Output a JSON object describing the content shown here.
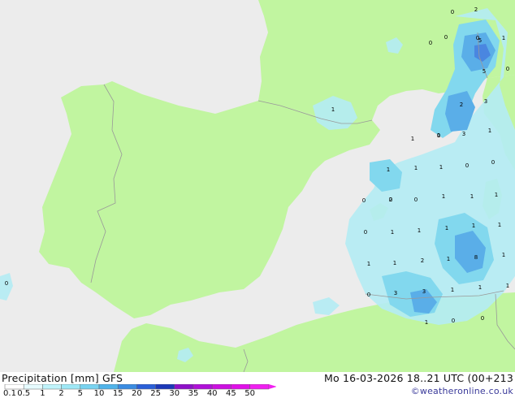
{
  "header": {
    "parameter": "Precipitation [mm]",
    "model": "GFS",
    "valid_time": "Mo 16-03-2026 18..21 UTC (00+213",
    "credit": "©weatheronline.co.uk"
  },
  "colors": {
    "sea": "#ececec",
    "land": "#c1f5a0",
    "precip_light": "#b4ecf4",
    "precip_mid": "#82d8ee",
    "precip_heavy": "#5aaee8",
    "precip_core": "#4a86e0",
    "border": "#999999"
  },
  "scale": {
    "labels": [
      "0.1",
      "0.5",
      "1",
      "2",
      "5",
      "10",
      "15",
      "20",
      "25",
      "30",
      "35",
      "40",
      "45",
      "50"
    ],
    "colors": [
      "#ffffff",
      "#e6fbff",
      "#bff3fb",
      "#9ee8f6",
      "#78d3f0",
      "#50b4ea",
      "#3a8ce2",
      "#2a5fd8",
      "#1c38b8",
      "#8e10c8",
      "#b010d8",
      "#cc10e0",
      "#e010e8",
      "#f020f0"
    ]
  },
  "map_labels": [
    {
      "text": "0"
    },
    {
      "text": "2"
    },
    {
      "text": "0"
    },
    {
      "text": "0"
    },
    {
      "text": "5"
    },
    {
      "text": "1"
    },
    {
      "text": "0"
    },
    {
      "text": "5"
    },
    {
      "text": "0"
    },
    {
      "text": "1"
    },
    {
      "text": "2"
    },
    {
      "text": "3"
    },
    {
      "text": "1"
    },
    {
      "text": "3"
    },
    {
      "text": "1"
    },
    {
      "text": "1"
    },
    {
      "text": "0"
    },
    {
      "text": "0"
    },
    {
      "text": "1"
    },
    {
      "text": "1"
    },
    {
      "text": "1"
    },
    {
      "text": "0"
    },
    {
      "text": "0"
    },
    {
      "text": "0"
    },
    {
      "text": "2"
    },
    {
      "text": "1"
    },
    {
      "text": "1"
    },
    {
      "text": "1"
    },
    {
      "text": "1"
    },
    {
      "text": "1"
    },
    {
      "text": "0"
    },
    {
      "text": "1"
    },
    {
      "text": "1"
    },
    {
      "text": "1"
    },
    {
      "text": "1"
    },
    {
      "text": "1"
    },
    {
      "text": "2"
    },
    {
      "text": "1"
    },
    {
      "text": "8"
    },
    {
      "text": "1"
    },
    {
      "text": "0"
    },
    {
      "text": "3"
    },
    {
      "text": "3"
    },
    {
      "text": "1"
    },
    {
      "text": "1"
    },
    {
      "text": "1"
    },
    {
      "text": "1"
    },
    {
      "text": "0"
    },
    {
      "text": "0"
    },
    {
      "text": "0"
    },
    {
      "text": "0"
    }
  ]
}
